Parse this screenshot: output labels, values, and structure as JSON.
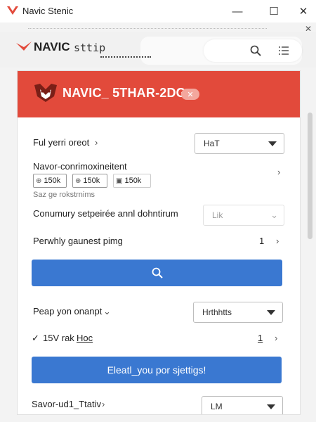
{
  "window": {
    "title": "Navic Stenic",
    "minimize": "—",
    "maximize": "☐",
    "close": "✕",
    "secondary_close": "✕"
  },
  "brand": {
    "name": "NAVIC",
    "subtitle": "sttip"
  },
  "banner": {
    "title": "NAVIC_ 5THAR-2DG",
    "chip": "✕",
    "color": "#e24a3b"
  },
  "rows": {
    "r1": {
      "label": "Ful yerri oreot",
      "chevron": "›",
      "select_value": "HaT"
    },
    "r2": {
      "label": "Navor-conrimoxineitent",
      "chevron": "›",
      "chips": [
        {
          "icon": "⊕",
          "text": "150k"
        },
        {
          "icon": "⊕",
          "text": "150k"
        },
        {
          "icon": "▣",
          "text": "150k"
        }
      ]
    },
    "r3": {
      "caption": "Saz ge rokstrnims"
    },
    "r4": {
      "label": "Conumury setpeirée annl dohntirum",
      "select_value": "Lik",
      "chevron": "⌄"
    },
    "r5": {
      "label": "Perwhly gaunest pimg",
      "count": "1",
      "chevron": "›"
    },
    "r6": {
      "label": "Peap yon onanpt",
      "chevron": "⌄",
      "select_value": "Hrthhtts"
    },
    "r7": {
      "check": "✓",
      "label": "15V rak",
      "link": "Hoc",
      "count": "1",
      "chevron": "›"
    },
    "r8": {
      "button_label": "Eleatl_you por sjettigs!"
    },
    "r9": {
      "label": "Savor-ud1_Ttativ",
      "chevron": "›",
      "select_value": "LM"
    }
  },
  "colors": {
    "accent_blue": "#3a78d1",
    "banner_red": "#e24a3b"
  },
  "icons": {
    "search": "search-icon",
    "menu": "menu-list-icon",
    "logo": "navic-logo-icon"
  }
}
